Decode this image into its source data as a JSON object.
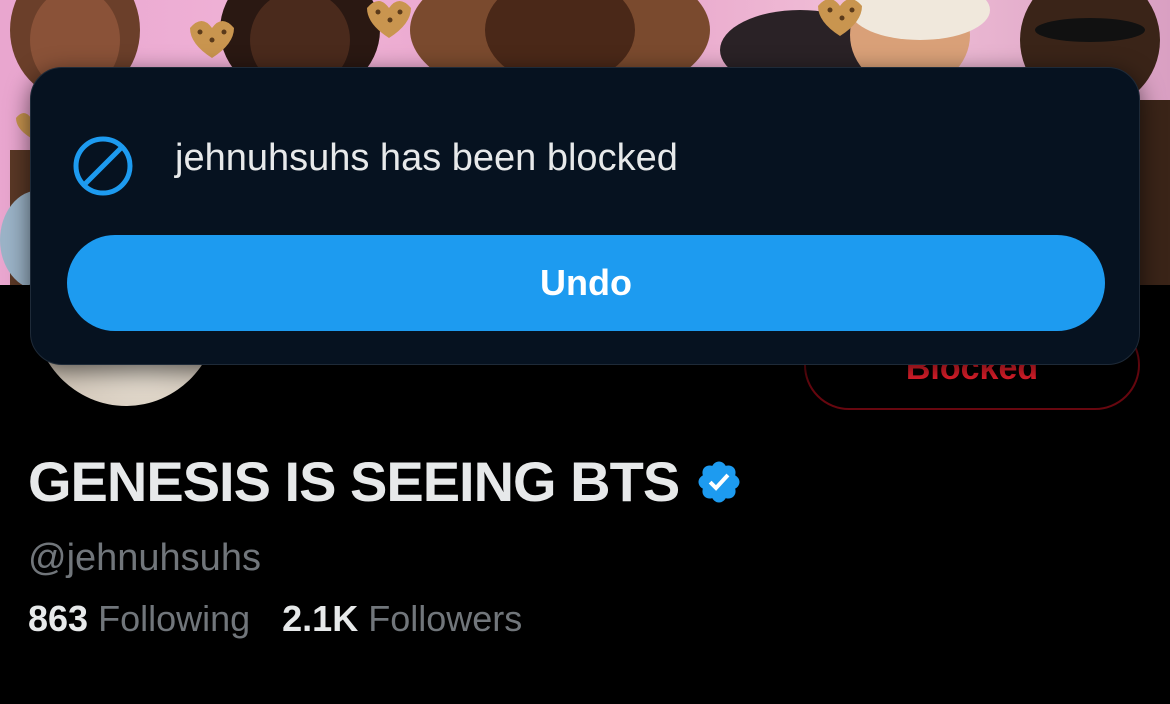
{
  "toast": {
    "message": "jehnuhsuhs has been blocked",
    "undo_label": "Undo",
    "icon": "blocked-circle-icon"
  },
  "profile": {
    "display_name": "GENESIS IS SEEING BTS",
    "handle": "@jehnuhsuhs",
    "verified": true,
    "blocked_label": "Blocked",
    "following_count": "863",
    "following_label": "Following",
    "followers_count": "2.1K",
    "followers_label": "Followers"
  },
  "colors": {
    "accent": "#1d9bf0",
    "block_red": "#f4212e",
    "background": "#000000",
    "toast_background": "#061220",
    "secondary_text": "#71767b",
    "primary_text": "#e7e9ea"
  }
}
